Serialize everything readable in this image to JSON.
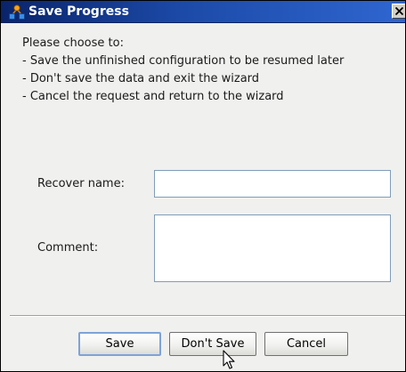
{
  "window": {
    "title": "Save Progress",
    "icons": {
      "app": "hierarchy-network-icon",
      "close": "close-icon",
      "cursor": "mouse-pointer-icon"
    },
    "colors": {
      "titlebar_start": "#0a246a",
      "titlebar_end": "#2f66d0",
      "background": "#f0f0ee",
      "default_button_border": "#7ea3d8"
    }
  },
  "intro": {
    "line1": "Please choose to:",
    "line2": "- Save the unfinished configuration to be resumed later",
    "line3": "- Don't save the data and exit the wizard",
    "line4": "- Cancel the request and return to the wizard"
  },
  "form": {
    "recover_label": "Recover name:",
    "recover_value": "",
    "comment_label": "Comment:",
    "comment_value": ""
  },
  "buttons": {
    "save": "Save",
    "dont_save": "Don't Save",
    "cancel": "Cancel"
  }
}
